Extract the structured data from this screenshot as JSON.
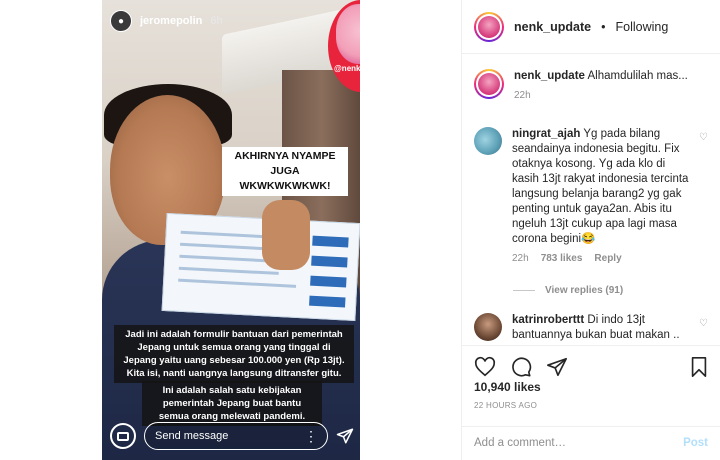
{
  "story": {
    "username": "jeromepolin",
    "time": "6h",
    "badge_text": "@nenk_update",
    "caption_top": "AKHIRNYA NYAMPE JUGA WKWKWKWKWK!",
    "caption_middle": "Jadi ini adalah formulir bantuan dari pemerintah Jepang untuk semua orang yang tinggal di Jepang yaitu uang sebesar 100.000 yen (Rp 13jt). Kita isi, nanti uangnya langsung ditransfer gitu.",
    "caption_bottom": "Ini adalah salah satu kebijakan pemerintah Jepang buat bantu semua orang melewati pandemi.",
    "message_placeholder": "Send message"
  },
  "post": {
    "username": "nenk_update",
    "separator": "•",
    "follow_status": "Following"
  },
  "comments": [
    {
      "username": "nenk_update",
      "text": "Alhamdulilah mas...",
      "time": "22h"
    },
    {
      "username": "ningrat_ajah",
      "text": "Yg pada bilang seandainya indonesia begitu. Fix otaknya kosong. Yg ada klo di kasih 13jt rakyat indonesia tercinta langsung belanja barang2 yg gak penting untuk gaya2an. Abis itu ngeluh 13jt cukup apa lagi masa corona begini😂",
      "time": "22h",
      "likes": "783 likes",
      "reply": "Reply",
      "view_replies": "View replies (91)"
    },
    {
      "username": "katrinroberttt",
      "text": "Di indo 13jt bantuannya bukan buat makan .."
    }
  ],
  "actions": {
    "likes": "10,940 likes",
    "ago": "22 HOURS AGO",
    "comment_placeholder": "Add a comment…",
    "post_label": "Post"
  },
  "icons": {
    "like": "heart-icon",
    "comment": "comment-icon",
    "share": "send-icon",
    "save": "bookmark-icon",
    "camera": "camera-icon",
    "more": "more-dots-icon",
    "story_send": "send-icon"
  },
  "colors": {
    "post_button": "#b2dffc",
    "muted": "#8e8e8e",
    "text": "#262626"
  }
}
